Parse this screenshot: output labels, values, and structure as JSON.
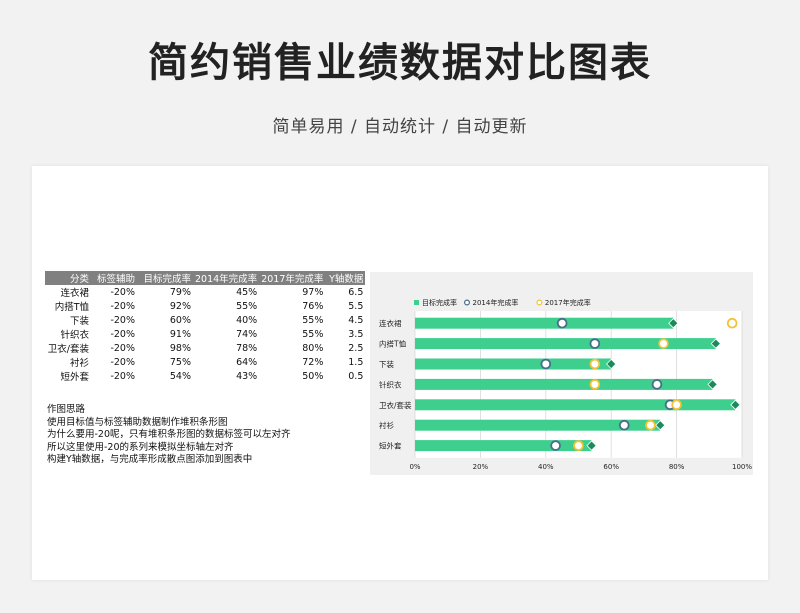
{
  "page": {
    "title": "简约销售业绩数据对比图表",
    "subtitle": "简单易用 / 自动统计 / 自动更新"
  },
  "table": {
    "headers": [
      "分类",
      "标签辅助",
      "目标完成率",
      "2014年完成率",
      "2017年完成率",
      "Y轴数据"
    ],
    "rows": [
      [
        "连衣裙",
        "-20%",
        "79%",
        "45%",
        "97%",
        "6.5"
      ],
      [
        "内搭T恤",
        "-20%",
        "92%",
        "55%",
        "76%",
        "5.5"
      ],
      [
        "下装",
        "-20%",
        "60%",
        "40%",
        "55%",
        "4.5"
      ],
      [
        "针织衣",
        "-20%",
        "91%",
        "74%",
        "55%",
        "3.5"
      ],
      [
        "卫衣/套装",
        "-20%",
        "98%",
        "78%",
        "80%",
        "2.5"
      ],
      [
        "衬衫",
        "-20%",
        "75%",
        "64%",
        "72%",
        "1.5"
      ],
      [
        "短外套",
        "-20%",
        "54%",
        "43%",
        "50%",
        "0.5"
      ]
    ]
  },
  "notes": [
    "作图思路",
    "使用目标值与标签辅助数据制作堆积条形图",
    "为什么要用-20呢，只有堆积条形图的数据标签可以左对齐",
    "所以这里使用-20的系列来模拟坐标轴左对齐",
    "构建Y轴数据，与完成率形成散点图添加到图表中"
  ],
  "colors": {
    "target": "#3ecf8e",
    "target_marker": "#1c8a5a",
    "y2014": "#4a6c8c",
    "y2017": "#f2c335",
    "table_header_bg": "#808080",
    "page_bg": "#f2f2f2"
  },
  "chart_data": {
    "type": "bar",
    "orientation": "horizontal",
    "categories": [
      "连衣裙",
      "内搭T恤",
      "下装",
      "针织衣",
      "卫衣/套装",
      "衬衫",
      "短外套"
    ],
    "series": [
      {
        "name": "目标完成率",
        "kind": "bar",
        "values": [
          79,
          92,
          60,
          91,
          98,
          75,
          54
        ]
      },
      {
        "name": "2014年完成率",
        "kind": "scatter",
        "marker": "circle",
        "values": [
          45,
          55,
          40,
          74,
          78,
          64,
          43
        ]
      },
      {
        "name": "2017年完成率",
        "kind": "scatter",
        "marker": "circle",
        "values": [
          97,
          76,
          55,
          55,
          80,
          72,
          50
        ]
      }
    ],
    "xlim": [
      0,
      100
    ],
    "xticks": [
      "0%",
      "20%",
      "40%",
      "60%",
      "80%",
      "100%"
    ],
    "legend_position": "top-left",
    "grid": "vertical"
  }
}
